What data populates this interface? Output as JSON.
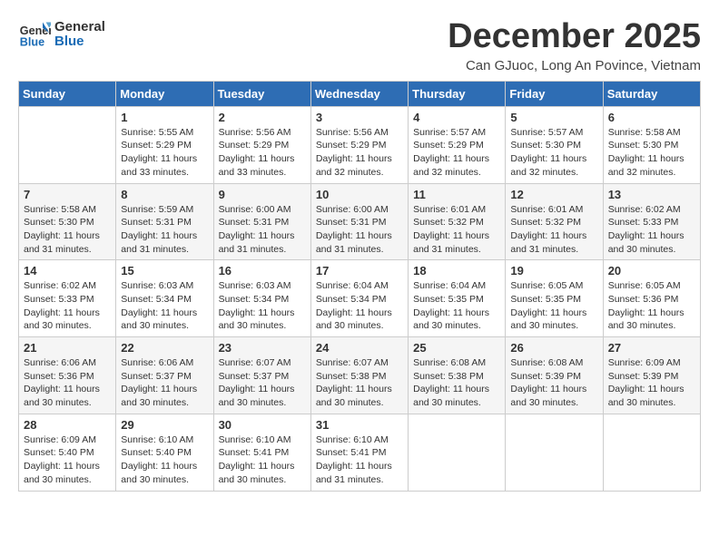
{
  "header": {
    "logo_general": "General",
    "logo_blue": "Blue",
    "month_title": "December 2025",
    "subtitle": "Can GJuoc, Long An Povince, Vietnam"
  },
  "days_of_week": [
    "Sunday",
    "Monday",
    "Tuesday",
    "Wednesday",
    "Thursday",
    "Friday",
    "Saturday"
  ],
  "weeks": [
    [
      {
        "day": "",
        "info": ""
      },
      {
        "day": "1",
        "info": "Sunrise: 5:55 AM\nSunset: 5:29 PM\nDaylight: 11 hours\nand 33 minutes."
      },
      {
        "day": "2",
        "info": "Sunrise: 5:56 AM\nSunset: 5:29 PM\nDaylight: 11 hours\nand 33 minutes."
      },
      {
        "day": "3",
        "info": "Sunrise: 5:56 AM\nSunset: 5:29 PM\nDaylight: 11 hours\nand 32 minutes."
      },
      {
        "day": "4",
        "info": "Sunrise: 5:57 AM\nSunset: 5:29 PM\nDaylight: 11 hours\nand 32 minutes."
      },
      {
        "day": "5",
        "info": "Sunrise: 5:57 AM\nSunset: 5:30 PM\nDaylight: 11 hours\nand 32 minutes."
      },
      {
        "day": "6",
        "info": "Sunrise: 5:58 AM\nSunset: 5:30 PM\nDaylight: 11 hours\nand 32 minutes."
      }
    ],
    [
      {
        "day": "7",
        "info": "Sunrise: 5:58 AM\nSunset: 5:30 PM\nDaylight: 11 hours\nand 31 minutes."
      },
      {
        "day": "8",
        "info": "Sunrise: 5:59 AM\nSunset: 5:31 PM\nDaylight: 11 hours\nand 31 minutes."
      },
      {
        "day": "9",
        "info": "Sunrise: 6:00 AM\nSunset: 5:31 PM\nDaylight: 11 hours\nand 31 minutes."
      },
      {
        "day": "10",
        "info": "Sunrise: 6:00 AM\nSunset: 5:31 PM\nDaylight: 11 hours\nand 31 minutes."
      },
      {
        "day": "11",
        "info": "Sunrise: 6:01 AM\nSunset: 5:32 PM\nDaylight: 11 hours\nand 31 minutes."
      },
      {
        "day": "12",
        "info": "Sunrise: 6:01 AM\nSunset: 5:32 PM\nDaylight: 11 hours\nand 31 minutes."
      },
      {
        "day": "13",
        "info": "Sunrise: 6:02 AM\nSunset: 5:33 PM\nDaylight: 11 hours\nand 30 minutes."
      }
    ],
    [
      {
        "day": "14",
        "info": "Sunrise: 6:02 AM\nSunset: 5:33 PM\nDaylight: 11 hours\nand 30 minutes."
      },
      {
        "day": "15",
        "info": "Sunrise: 6:03 AM\nSunset: 5:34 PM\nDaylight: 11 hours\nand 30 minutes."
      },
      {
        "day": "16",
        "info": "Sunrise: 6:03 AM\nSunset: 5:34 PM\nDaylight: 11 hours\nand 30 minutes."
      },
      {
        "day": "17",
        "info": "Sunrise: 6:04 AM\nSunset: 5:34 PM\nDaylight: 11 hours\nand 30 minutes."
      },
      {
        "day": "18",
        "info": "Sunrise: 6:04 AM\nSunset: 5:35 PM\nDaylight: 11 hours\nand 30 minutes."
      },
      {
        "day": "19",
        "info": "Sunrise: 6:05 AM\nSunset: 5:35 PM\nDaylight: 11 hours\nand 30 minutes."
      },
      {
        "day": "20",
        "info": "Sunrise: 6:05 AM\nSunset: 5:36 PM\nDaylight: 11 hours\nand 30 minutes."
      }
    ],
    [
      {
        "day": "21",
        "info": "Sunrise: 6:06 AM\nSunset: 5:36 PM\nDaylight: 11 hours\nand 30 minutes."
      },
      {
        "day": "22",
        "info": "Sunrise: 6:06 AM\nSunset: 5:37 PM\nDaylight: 11 hours\nand 30 minutes."
      },
      {
        "day": "23",
        "info": "Sunrise: 6:07 AM\nSunset: 5:37 PM\nDaylight: 11 hours\nand 30 minutes."
      },
      {
        "day": "24",
        "info": "Sunrise: 6:07 AM\nSunset: 5:38 PM\nDaylight: 11 hours\nand 30 minutes."
      },
      {
        "day": "25",
        "info": "Sunrise: 6:08 AM\nSunset: 5:38 PM\nDaylight: 11 hours\nand 30 minutes."
      },
      {
        "day": "26",
        "info": "Sunrise: 6:08 AM\nSunset: 5:39 PM\nDaylight: 11 hours\nand 30 minutes."
      },
      {
        "day": "27",
        "info": "Sunrise: 6:09 AM\nSunset: 5:39 PM\nDaylight: 11 hours\nand 30 minutes."
      }
    ],
    [
      {
        "day": "28",
        "info": "Sunrise: 6:09 AM\nSunset: 5:40 PM\nDaylight: 11 hours\nand 30 minutes."
      },
      {
        "day": "29",
        "info": "Sunrise: 6:10 AM\nSunset: 5:40 PM\nDaylight: 11 hours\nand 30 minutes."
      },
      {
        "day": "30",
        "info": "Sunrise: 6:10 AM\nSunset: 5:41 PM\nDaylight: 11 hours\nand 30 minutes."
      },
      {
        "day": "31",
        "info": "Sunrise: 6:10 AM\nSunset: 5:41 PM\nDaylight: 11 hours\nand 31 minutes."
      },
      {
        "day": "",
        "info": ""
      },
      {
        "day": "",
        "info": ""
      },
      {
        "day": "",
        "info": ""
      }
    ]
  ]
}
